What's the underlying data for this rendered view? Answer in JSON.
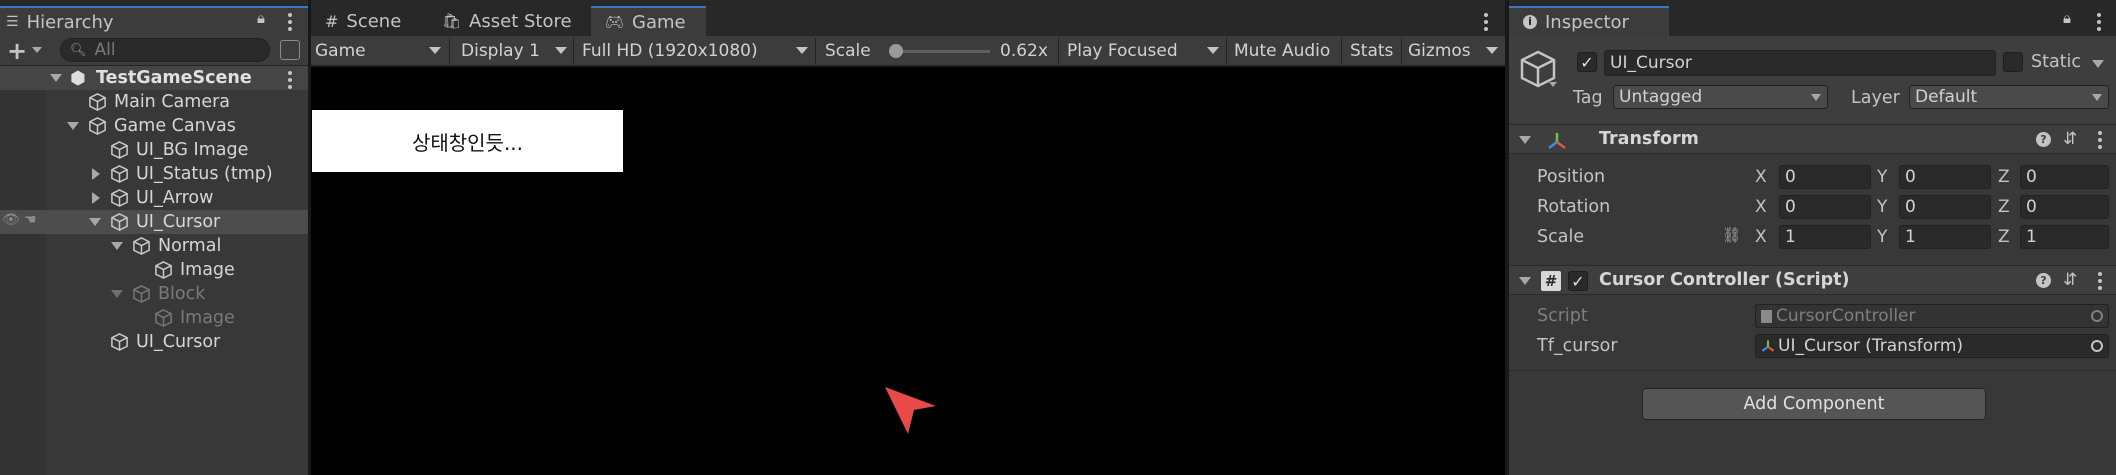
{
  "hierarchy": {
    "tab_label": "Hierarchy",
    "search_placeholder": "All",
    "scene_name": "TestGameScene",
    "items": [
      {
        "label": "Main Camera"
      },
      {
        "label": "Game Canvas"
      },
      {
        "label": "UI_BG Image"
      },
      {
        "label": "UI_Status (tmp)"
      },
      {
        "label": "UI_Arrow"
      },
      {
        "label": "UI_Cursor"
      },
      {
        "label": "Normal"
      },
      {
        "label": "Image"
      },
      {
        "label": "Block"
      },
      {
        "label": "Image"
      },
      {
        "label": "UI_Cursor"
      }
    ]
  },
  "center": {
    "tabs": [
      {
        "label": "Scene",
        "icon": "grid-icon"
      },
      {
        "label": "Asset Store",
        "icon": "bag-icon"
      },
      {
        "label": "Game",
        "icon": "gamepad-icon"
      }
    ],
    "toolbar": {
      "view_mode": "Game",
      "display": "Display 1",
      "resolution": "Full HD (1920x1080)",
      "scale_label": "Scale",
      "scale_value": "0.62x",
      "scale_fraction": 0.0,
      "play_mode": "Play Focused",
      "mute_audio": "Mute Audio",
      "stats": "Stats",
      "gizmos": "Gizmos"
    },
    "game_view": {
      "status_box_text": "상태창인듯..."
    }
  },
  "inspector": {
    "tab_label": "Inspector",
    "object_name": "UI_Cursor",
    "static_label": "Static",
    "tag_label": "Tag",
    "tag_value": "Untagged",
    "layer_label": "Layer",
    "layer_value": "Default",
    "transform": {
      "title": "Transform",
      "rows": [
        {
          "label": "Position",
          "x": "0",
          "y": "0",
          "z": "0"
        },
        {
          "label": "Rotation",
          "x": "0",
          "y": "0",
          "z": "0"
        },
        {
          "label": "Scale",
          "x": "1",
          "y": "1",
          "z": "1"
        }
      ],
      "axis_x": "X",
      "axis_y": "Y",
      "axis_z": "Z"
    },
    "script_component": {
      "title": "Cursor Controller (Script)",
      "script_label": "Script",
      "script_value": "CursorController",
      "tf_label": "Tf_cursor",
      "tf_value": "UI_Cursor (Transform)"
    },
    "add_component": "Add Component"
  },
  "colors": {
    "accent_blue": "#3a79bb",
    "cursor_red": "#e84a4a",
    "selected_row": "#4d4d4d"
  }
}
